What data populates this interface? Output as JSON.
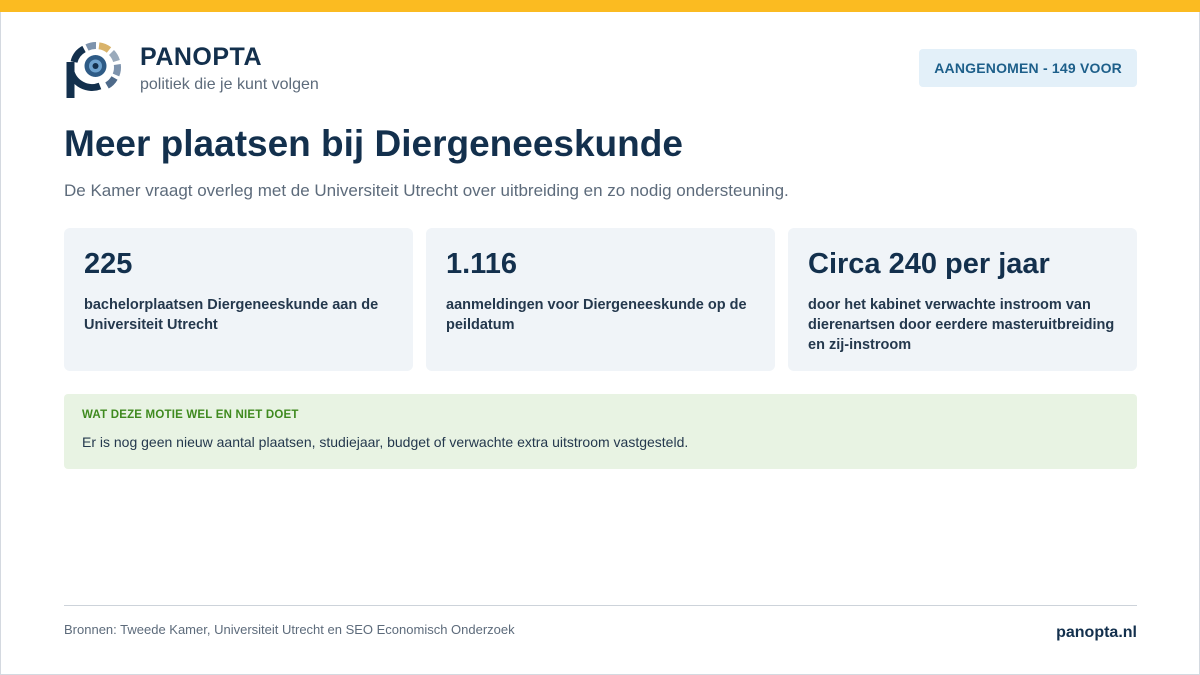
{
  "brand": {
    "name": "PANOPTA",
    "tagline": "politiek die je kunt volgen",
    "logo_icon": "eye-logo-icon"
  },
  "status": {
    "label": "AANGENOMEN - 149 VOOR"
  },
  "article": {
    "title": "Meer plaatsen bij Diergeneeskunde",
    "subtitle": "De Kamer vraagt overleg met de Universiteit Utrecht over uitbreiding en zo nodig ondersteuning."
  },
  "stats": [
    {
      "value": "225",
      "label": "bachelorplaatsen Diergeneeskunde aan de Universiteit Utrecht"
    },
    {
      "value": "1.116",
      "label": "aanmeldingen voor Diergeneeskunde op de peildatum"
    },
    {
      "value": "Circa 240 per jaar",
      "label": "door het kabinet verwachte instroom van dierenartsen door eerdere masteruitbreiding en zij-instroom"
    }
  ],
  "note": {
    "heading": "WAT DEZE MOTIE WEL EN NIET DOET",
    "text": "Er is nog geen nieuw aantal plaatsen, studiejaar, budget of verwachte extra uitstroom vastgesteld."
  },
  "footer": {
    "sources": "Bronnen: Tweede Kamer, Universiteit Utrecht en SEO Economisch Onderzoek",
    "site": "panopta.nl"
  },
  "colors": {
    "accent_bar": "#fbbb21",
    "brand_navy": "#13304d",
    "badge_bg": "#e3f0f9",
    "badge_text": "#1d5f8a",
    "note_bg": "#e8f3e3",
    "note_heading": "#3f8a1f"
  }
}
